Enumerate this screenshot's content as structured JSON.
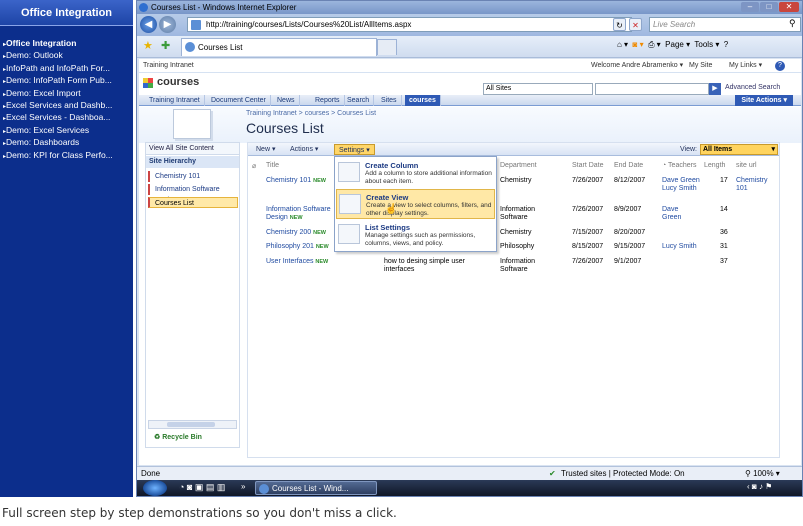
{
  "left_pane": {
    "title": "Office Integration",
    "items": [
      {
        "label": "Office Integration",
        "active": true
      },
      {
        "label": "Demo: Outlook"
      },
      {
        "label": "InfoPath and InfoPath For..."
      },
      {
        "label": "Demo: InfoPath Form Pub..."
      },
      {
        "label": "Demo: Excel Import"
      },
      {
        "label": "Excel Services and Dashb..."
      },
      {
        "label": "Excel Services - Dashboa..."
      },
      {
        "label": "Demo: Excel Services"
      },
      {
        "label": "Demo: Dashboards"
      },
      {
        "label": "Demo: KPI for Class Perfo..."
      }
    ]
  },
  "browser": {
    "window_title": "Courses List - Windows Internet Explorer",
    "url": "http://training/courses/Lists/Courses%20List/AllItems.aspx",
    "search_placeholder": "Live Search",
    "tab_title": "Courses List",
    "tools": {
      "page": "Page",
      "tools": "Tools"
    },
    "status_left": "Done",
    "status_zone": "Trusted sites | Protected Mode: On",
    "zoom": "100%"
  },
  "site": {
    "top_left": "Training Intranet",
    "welcome": "Welcome Andre Abramenko",
    "my_site": "My Site",
    "my_links": "My Links",
    "site_name": "courses",
    "scope": "All Sites",
    "advanced_search": "Advanced Search",
    "nav_tabs": [
      "Training Intranet",
      "Document Center",
      "News",
      "Reports",
      "Search",
      "Sites",
      "courses"
    ],
    "site_actions": "Site Actions",
    "breadcrumb": "Training Intranet > courses > Courses List",
    "page_title": "Courses List"
  },
  "quick_launch": {
    "view_all": "View All Site Content",
    "hierarchy_title": "Site Hierarchy",
    "items": [
      "Chemistry 101",
      "Information Software Design",
      "Courses List"
    ],
    "recycle_bin": "Recycle Bin"
  },
  "toolbar": {
    "new": "New",
    "actions": "Actions",
    "settings": "Settings",
    "view_label": "View:",
    "view_value": "All Items"
  },
  "settings_menu": [
    {
      "title": "Create Column",
      "desc": "Add a column to store additional information about each item."
    },
    {
      "title": "Create View",
      "desc": "Create a view to select columns, filters, and other display settings."
    },
    {
      "title": "List Settings",
      "desc": "Manage settings such as permissions, columns, views, and policy."
    }
  ],
  "table": {
    "headers": [
      "Title",
      "Department",
      "Start Date",
      "End Date",
      "Teachers",
      "Length",
      "site url"
    ],
    "rows": [
      {
        "title": "Chemistry 101",
        "description": "",
        "department": "Chemistry",
        "start": "7/26/2007",
        "end": "8/12/2007",
        "teachers": "Dave Green\nLucy Smith",
        "length": "17",
        "url": "Chemistry 101"
      },
      {
        "title": "Information Software Design",
        "description": "",
        "department": "Information Software",
        "start": "7/26/2007",
        "end": "8/9/2007",
        "teachers": "Dave Green",
        "length": "14",
        "url": ""
      },
      {
        "title": "Chemistry 200",
        "description": "",
        "department": "Chemistry",
        "start": "7/15/2007",
        "end": "8/20/2007",
        "teachers": "",
        "length": "36",
        "url": ""
      },
      {
        "title": "Philosophy 201",
        "description": "",
        "department": "Philosophy",
        "start": "8/15/2007",
        "end": "9/15/2007",
        "teachers": "Lucy Smith",
        "length": "31",
        "url": ""
      },
      {
        "title": "User Interfaces",
        "description": "how to desing simple user interfaces",
        "department": "Information Software",
        "start": "7/26/2007",
        "end": "9/1/2007",
        "teachers": "",
        "length": "37",
        "url": ""
      }
    ],
    "new_badge": "NEW"
  },
  "taskbar": {
    "item": "Courses List - Wind..."
  },
  "caption": "Full screen step by step demonstrations so you don't miss a click."
}
